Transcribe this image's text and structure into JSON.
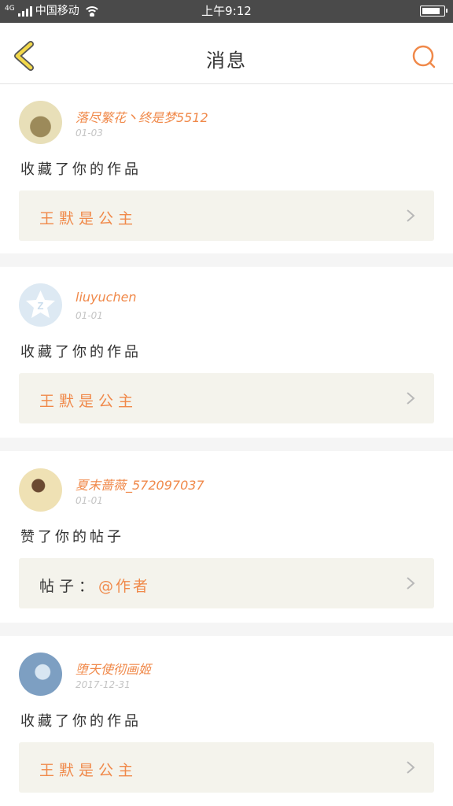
{
  "status_bar": {
    "network": "4G",
    "carrier": "中国移动",
    "time": "上午9:12"
  },
  "header": {
    "title": "消息"
  },
  "notifications": [
    {
      "username": "落尽繁花丶终是梦5512",
      "date": "01-03",
      "action": "收藏了你的作品",
      "ref_prefix": "",
      "ref_text": "王默是公主",
      "avatar_colors": [
        "#e8dfb8",
        "#9c8a5a"
      ]
    },
    {
      "username": "liuyuchen",
      "date": "01-01",
      "action": "收藏了你的作品",
      "ref_prefix": "",
      "ref_text": "王默是公主",
      "avatar_colors": [
        "#dde9f3",
        "#ffffff"
      ]
    },
    {
      "username": "夏末蔷薇_572097037",
      "date": "01-01",
      "action": "赞了你的帖子",
      "ref_prefix": "帖子：",
      "ref_text": "@作者",
      "avatar_colors": [
        "#efe1b4",
        "#6b4a32"
      ]
    },
    {
      "username": "堕天使彻画姬",
      "date": "2017-12-31",
      "action": "收藏了你的作品",
      "ref_prefix": "",
      "ref_text": "王默是公主",
      "avatar_colors": [
        "#7d9fc2",
        "#d8e6f2"
      ]
    }
  ],
  "colors": {
    "accent": "#f0894a",
    "back_icon": "#f2d84a",
    "status_bar": "#4a4a4a",
    "ref_box": "#f4f3ec"
  },
  "icons": [
    "back-arrow-icon",
    "search-icon",
    "chevron-right-icon",
    "signal-icon",
    "wifi-icon",
    "battery-icon"
  ]
}
